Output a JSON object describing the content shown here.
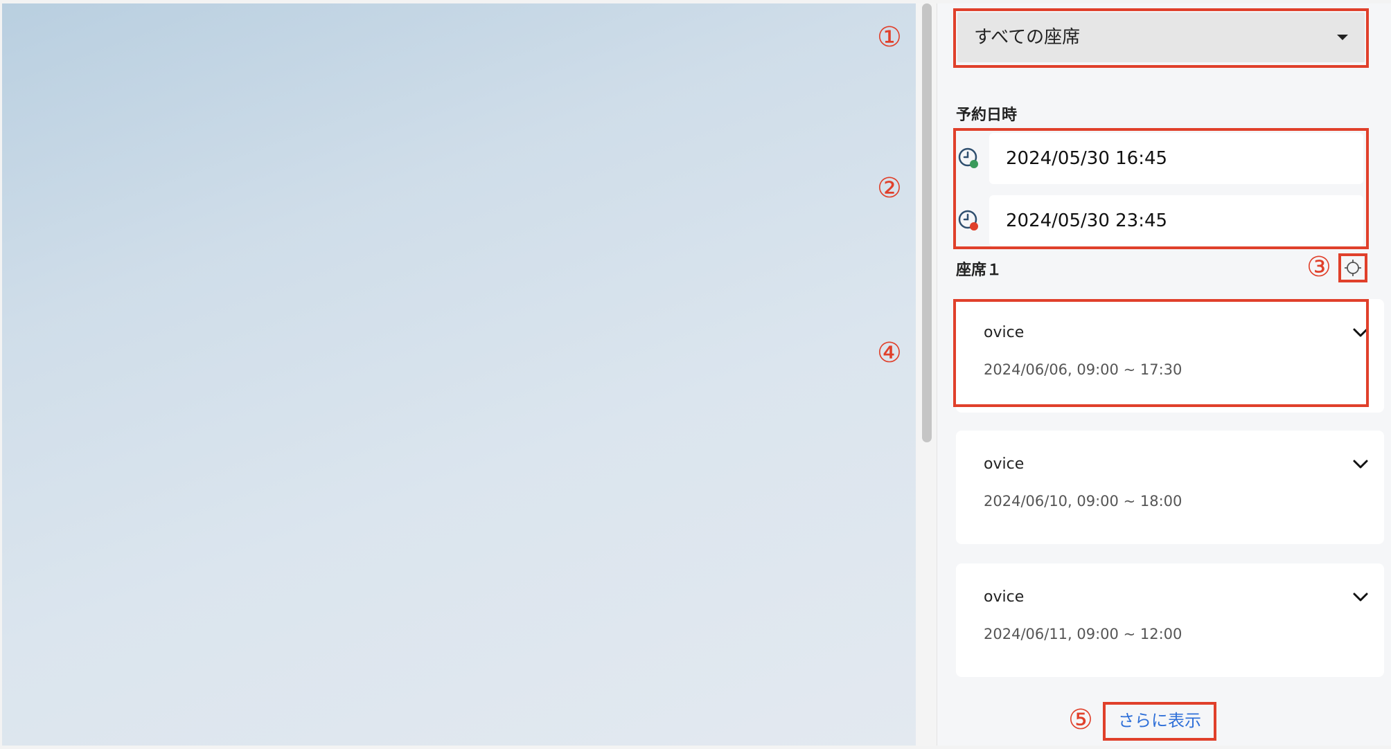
{
  "markers": [
    "①",
    "②",
    "③",
    "④",
    "⑤"
  ],
  "seat_select": {
    "value": "すべての座席"
  },
  "reservation": {
    "label": "予約日時",
    "start": "2024/05/30 16:45",
    "end": "2024/05/30 23:45"
  },
  "seat_section": {
    "label": "座席１"
  },
  "reservations": [
    {
      "name": "ovice",
      "time": "2024/06/06, 09:00 ~ 17:30"
    },
    {
      "name": "ovice",
      "time": "2024/06/10, 09:00 ~ 18:00"
    },
    {
      "name": "ovice",
      "time": "2024/06/11, 09:00 ~ 12:00"
    }
  ],
  "show_more": {
    "label": "さらに表示"
  },
  "colors": {
    "annotation": "#e0402b",
    "link": "#2e6fd8",
    "start_dot": "#3a9a5b",
    "end_dot": "#e0402b"
  },
  "icons": {
    "select_caret": "caret-down-icon",
    "start_clock": "clock-start-icon",
    "end_clock": "clock-end-icon",
    "locate": "crosshair-icon",
    "expand": "chevron-down-icon"
  }
}
